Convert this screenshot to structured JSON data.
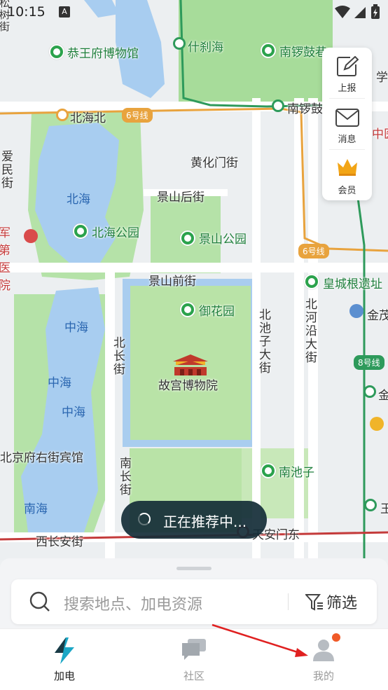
{
  "status_bar": {
    "time": "10:15",
    "notif_icon": "A"
  },
  "map": {
    "roads": {
      "beihaibei": "北海北",
      "huanghuamen": "黄化门街",
      "jingshanhou": "景山后街",
      "jingshanqian": "景山前街",
      "beichang": "北长街",
      "nanchang": "南长街",
      "beichizi": "北池子大街",
      "beiheyan": "北河沿大街",
      "xichangan": "西长安街",
      "tiananmendong": "天安门东"
    },
    "pois": {
      "gongwangfu": "恭王府博物馆",
      "shichahai": "什刹海",
      "nanluoguxiang": "南锣鼓巷",
      "nanluogu2": "南锣鼓",
      "beihai_park": "北海公园",
      "jingshan_park": "景山公园",
      "yuhuayuan": "御花园",
      "gugong": "故宫博物院",
      "huangchenggen": "皇城根遗址",
      "nanchizi": "南池子",
      "jin": "金茂",
      "jin2": "金",
      "wang": "王",
      "fuyoujie": "北京府右街宾馆",
      "hospital": "军第\n医院",
      "xue": "学",
      "yi": "中医"
    },
    "water": {
      "beihai": "北海",
      "zhonghai1": "中海",
      "zhonghai2": "中海",
      "zhonghai3": "中海",
      "nanhai": "南海"
    },
    "metro": {
      "line6a": "6号线",
      "line6b": "6号线",
      "line8": "8号线"
    },
    "left_edge": {
      "top": "松树街",
      "mid": "爱民街"
    }
  },
  "float_panel": {
    "report": "上报",
    "message": "消息",
    "member": "会员"
  },
  "toast": {
    "text": "正在推荐中..."
  },
  "search": {
    "placeholder": "搜索地点、加电资源",
    "filter": "筛选"
  },
  "tabs": [
    {
      "label": "加电"
    },
    {
      "label": "社区"
    },
    {
      "label": "我的"
    }
  ],
  "colors": {
    "accent": "#1ba7c6",
    "toast": "#142d37",
    "badge": "#f05a28",
    "arrow": "#e02020"
  }
}
